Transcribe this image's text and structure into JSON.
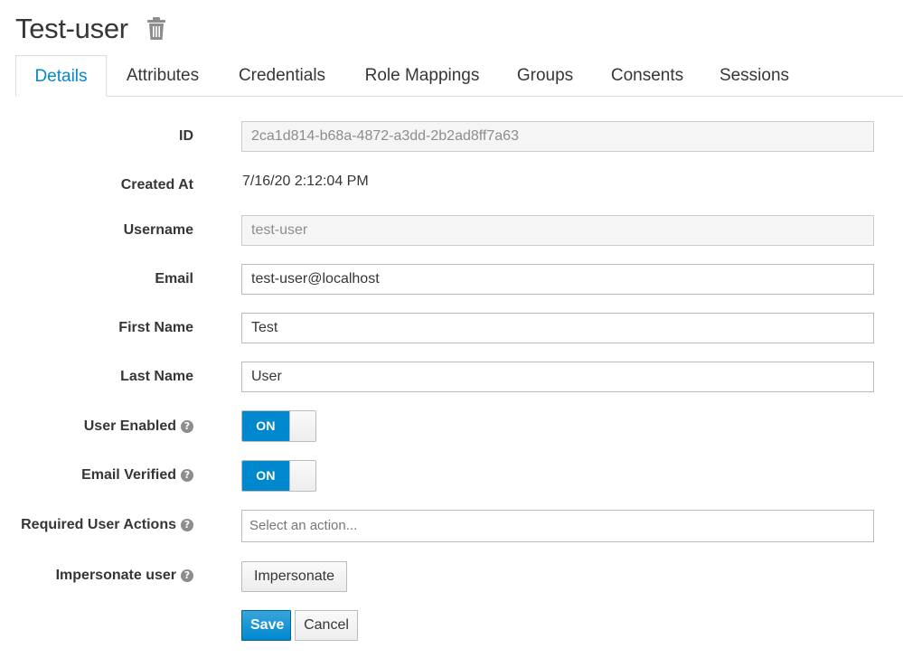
{
  "header": {
    "title": "Test-user"
  },
  "tabs": [
    {
      "label": "Details",
      "active": true
    },
    {
      "label": "Attributes"
    },
    {
      "label": "Credentials"
    },
    {
      "label": "Role Mappings"
    },
    {
      "label": "Groups"
    },
    {
      "label": "Consents"
    },
    {
      "label": "Sessions"
    }
  ],
  "form": {
    "id": {
      "label": "ID",
      "value": "2ca1d814-b68a-4872-a3dd-2b2ad8ff7a63"
    },
    "created_at": {
      "label": "Created At",
      "value": "7/16/20 2:12:04 PM"
    },
    "username": {
      "label": "Username",
      "value": "test-user"
    },
    "email": {
      "label": "Email",
      "value": "test-user@localhost"
    },
    "first_name": {
      "label": "First Name",
      "value": "Test"
    },
    "last_name": {
      "label": "Last Name",
      "value": "User"
    },
    "user_enabled": {
      "label": "User Enabled",
      "state": "ON"
    },
    "email_verified": {
      "label": "Email Verified",
      "state": "ON"
    },
    "required_actions": {
      "label": "Required User Actions",
      "placeholder": "Select an action..."
    },
    "impersonate": {
      "label": "Impersonate user",
      "button": "Impersonate"
    }
  },
  "actions": {
    "save": "Save",
    "cancel": "Cancel"
  },
  "icons": {
    "delete": "trash-icon",
    "help": "question-circle-icon"
  },
  "colors": {
    "accent": "#0088ce",
    "text": "#363636"
  }
}
